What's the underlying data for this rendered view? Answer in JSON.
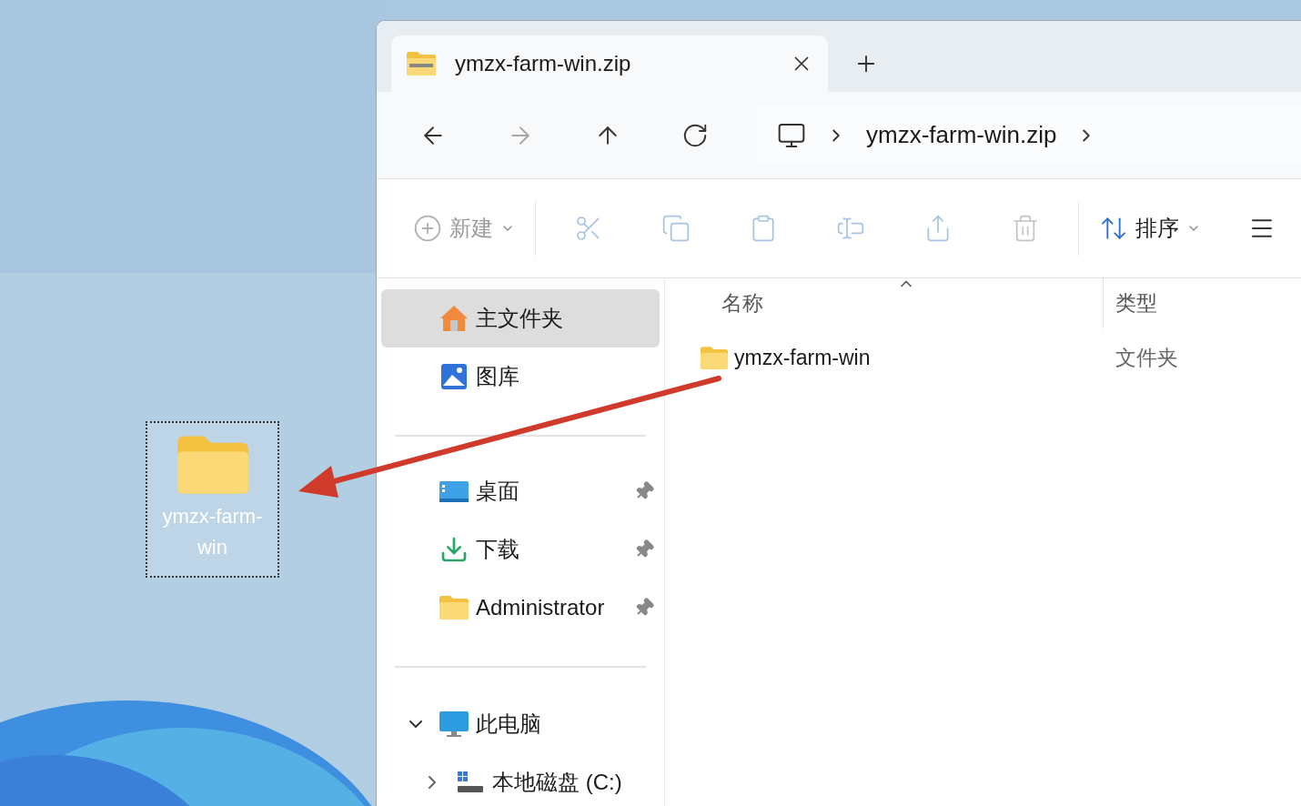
{
  "desktop": {
    "icon": {
      "label": "ymzx-farm-win",
      "selected": true
    }
  },
  "window": {
    "tabs": [
      {
        "title": "ymzx-farm-win.zip",
        "selected": true
      }
    ],
    "nav": [
      {
        "kind": "back",
        "disabled": false
      },
      {
        "kind": "forward",
        "disabled": true
      },
      {
        "kind": "up",
        "disabled": false
      },
      {
        "kind": "refresh",
        "disabled": false
      }
    ],
    "address": {
      "segments": [
        "ymzx-farm-win.zip"
      ]
    },
    "toolbar": [
      {
        "kind": "new",
        "label": "新建",
        "disabled": true
      },
      {
        "kind": "cut",
        "disabled": true
      },
      {
        "kind": "copy",
        "disabled": true
      },
      {
        "kind": "paste",
        "disabled": true
      },
      {
        "kind": "rename",
        "disabled": true
      },
      {
        "kind": "share",
        "disabled": true
      },
      {
        "kind": "delete",
        "disabled": true
      },
      {
        "kind": "sort",
        "label": "排序",
        "disabled": false
      }
    ],
    "sidebar": {
      "sections": [
        {
          "items": [
            {
              "kind": "home",
              "label": "主文件夹",
              "selected": true
            },
            {
              "kind": "gallery",
              "label": "图库",
              "selected": false
            }
          ]
        },
        {
          "items": [
            {
              "kind": "desktop",
              "label": "桌面",
              "selected": false,
              "pinned": true
            },
            {
              "kind": "download",
              "label": "下载",
              "selected": false,
              "pinned": true
            },
            {
              "kind": "folder",
              "label": "Administrator",
              "selected": false,
              "pinned": true
            }
          ]
        },
        {
          "items": [
            {
              "kind": "pc",
              "label": "此电脑",
              "selected": false,
              "expanded": true,
              "children": [
                {
                  "kind": "drive",
                  "label": "本地磁盘 (C:)",
                  "selected": false,
                  "expanded": false
                }
              ]
            }
          ]
        }
      ]
    },
    "columns": [
      {
        "label": "名称",
        "sorted": true
      },
      {
        "label": "类型"
      }
    ],
    "rows": [
      {
        "name": "ymzx-farm-win",
        "type": "文件夹"
      }
    ]
  }
}
